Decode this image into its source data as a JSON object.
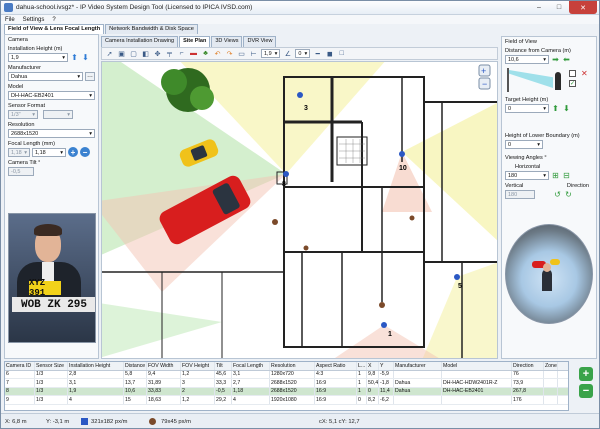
{
  "window": {
    "title": "dahua-school.ivsgz* - IP Video System Design Tool (Licensed to IPICA IVSD.com)",
    "minimize": "–",
    "maximize": "□",
    "close": "✕"
  },
  "menu": [
    "File",
    "Settings",
    "?"
  ],
  "main_tabs": [
    "Field of View & Lens Focal Length",
    "Network Bandwidth & Disk Space"
  ],
  "left": {
    "camera_group": "Camera",
    "installation_height_label": "Installation Height (m)",
    "installation_height": "1,9",
    "manufacturer_label": "Manufacturer",
    "manufacturer": "Dahua",
    "model_label": "Model",
    "model": "DH-HAC-EB2401",
    "sensor_format_label": "Sensor Format",
    "sensor_format": "1/3\"",
    "resolution_label": "Resolution",
    "resolution": "2688x1520",
    "focal_length_label": "Focal Length (mm)",
    "focal_length_min": "1,18",
    "focal_length": "1,18",
    "camera_tilt_label": "Camera Tilt °",
    "camera_tilt": "-0,5",
    "plate_top": "XYZ 391",
    "plate_bottom": "WOB ZK 295"
  },
  "sub_tabs": [
    "Camera Installation Drawing",
    "Site Plan",
    "3D Views",
    "DVR View"
  ],
  "toolbar": {
    "line_width": "1,9",
    "angle": "0"
  },
  "plan": {
    "camera_labels": [
      "3",
      "10",
      "8",
      "5",
      "1"
    ]
  },
  "right": {
    "fov_group": "Field of View",
    "distance_label": "Distance from Camera (m)",
    "distance": "10,6",
    "target_height_label": "Target Height (m)",
    "target_height": "0",
    "lower_boundary_label": "Height of Lower Boundary (m)",
    "lower_boundary": "0",
    "viewing_angles_label": "Viewing Angles °",
    "horizontal_label": "Horizontal",
    "horizontal": "180",
    "vertical_label": "Vertical",
    "vertical": "180",
    "direction_label": "Direction"
  },
  "table": {
    "columns": [
      "Camera ID",
      "Sensor Size",
      "Installation Height",
      "Distance",
      "FOV Width",
      "FOV Height",
      "Tilt",
      "Focal Length",
      "Resolution",
      "Aspect Ratio",
      "L...",
      "X",
      "Y",
      "Manufacturer",
      "Model",
      "Direction",
      "Zone"
    ],
    "rows": [
      [
        "6",
        "1/3",
        "2,8",
        "5,8",
        "9,4",
        "1,2",
        "45,6",
        "3,1",
        "1280x720",
        "4:3",
        "1",
        "9,8",
        "-5,9",
        "",
        "",
        "76",
        ""
      ],
      [
        "7",
        "1/3",
        "3,1",
        "13,7",
        "31,89",
        "3",
        "33,3",
        "2,7",
        "2688x1520",
        "16:9",
        "1",
        "50,4",
        "-1,8",
        "Dahua",
        "DH-HAC-HDW2401R-Z",
        "73,9",
        ""
      ],
      [
        "8",
        "1/3",
        "1,9",
        "10,6",
        "33,83",
        "2",
        "-0,5",
        "1,18",
        "2688x1520",
        "16:9",
        "1",
        "0",
        "11,4",
        "Dahua",
        "DH-HAC-EB2401",
        "267,8",
        ""
      ],
      [
        "9",
        "1/3",
        "4",
        "15",
        "18,63",
        "1,2",
        "29,2",
        "4",
        "1920x1080",
        "16:9",
        "0",
        "8,2",
        "-6,2",
        "",
        "",
        "176",
        ""
      ]
    ]
  },
  "status": {
    "x": "X: 6,8 m",
    "y": "Y: -3,1 m",
    "ppm1": "321x182 px/m",
    "ppm2": "79x45 px/m",
    "cxy": "cX: 5,1  cY: 12,7"
  }
}
